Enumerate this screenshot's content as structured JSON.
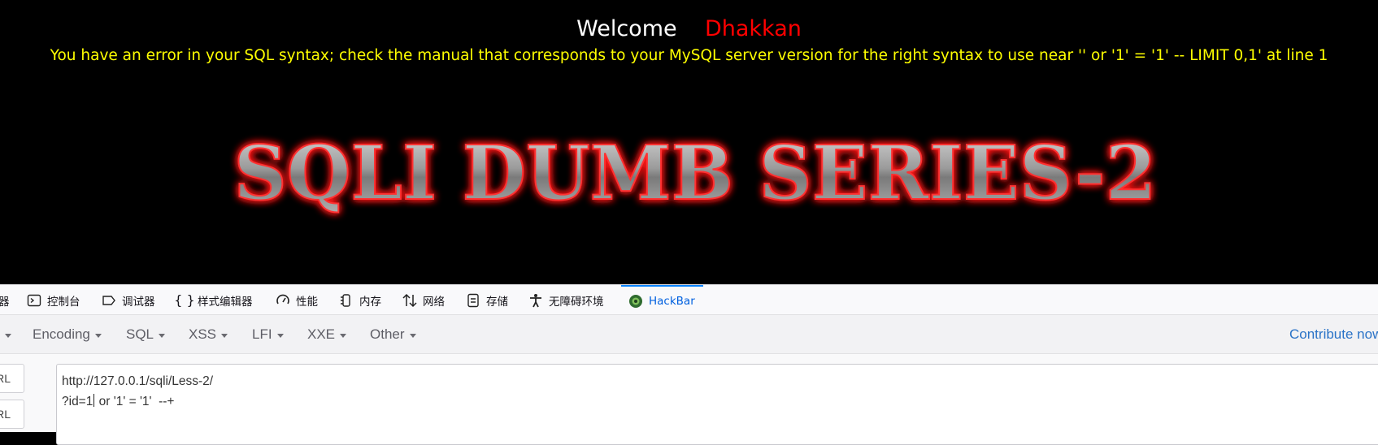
{
  "page": {
    "welcome_label": "Welcome",
    "welcome_name": "Dhakkan",
    "sql_error": "You have an error in your SQL syntax; check the manual that corresponds to your MySQL server version for the right syntax to use near '' or '1' = '1' -- LIMIT 0,1' at line 1",
    "banner_text": "SQLI DUMB SERIES-2"
  },
  "devtools": {
    "tabs": [
      {
        "label": "器",
        "icon": "inspector-icon"
      },
      {
        "label": "控制台",
        "icon": "console-icon"
      },
      {
        "label": "调试器",
        "icon": "debugger-icon"
      },
      {
        "label": "样式编辑器",
        "icon": "braces-icon"
      },
      {
        "label": "性能",
        "icon": "gauge-icon"
      },
      {
        "label": "内存",
        "icon": "memory-icon"
      },
      {
        "label": "网络",
        "icon": "network-icon"
      },
      {
        "label": "存储",
        "icon": "storage-icon"
      },
      {
        "label": "无障碍环境",
        "icon": "accessibility-icon"
      },
      {
        "label": "HackBar",
        "icon": "hackbar-icon",
        "active": true
      }
    ]
  },
  "hackbar": {
    "menu": [
      "Encoding",
      "SQL",
      "XSS",
      "LFI",
      "XXE",
      "Other"
    ],
    "contribute": "Contribute now",
    "buttons": [
      "Load URL",
      "Split URL"
    ],
    "url_line1": "http://127.0.0.1/sqli/Less-2/",
    "url_line2_before": "?id=1",
    "url_line2_after": " or '1' = '1'  --+"
  },
  "colors": {
    "page_bg": "#000000",
    "welcome": "#ffffff",
    "name": "#ff0000",
    "error": "#ffff00",
    "banner_glow": "#ff0000",
    "active_tab": "#0060df"
  }
}
